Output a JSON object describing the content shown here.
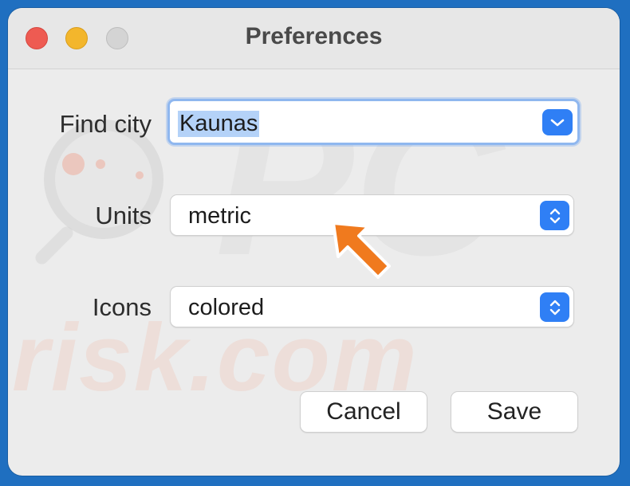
{
  "window": {
    "title": "Preferences"
  },
  "form": {
    "find_city": {
      "label": "Find city",
      "value": "Kaunas"
    },
    "units": {
      "label": "Units",
      "value": "metric"
    },
    "icons": {
      "label": "Icons",
      "value": "colored"
    }
  },
  "buttons": {
    "cancel": "Cancel",
    "save": "Save"
  },
  "colors": {
    "accent": "#2f7ff5",
    "arrow": "#f07a1e"
  },
  "watermark": {
    "text": "risk.com",
    "logo_text": "PC"
  }
}
